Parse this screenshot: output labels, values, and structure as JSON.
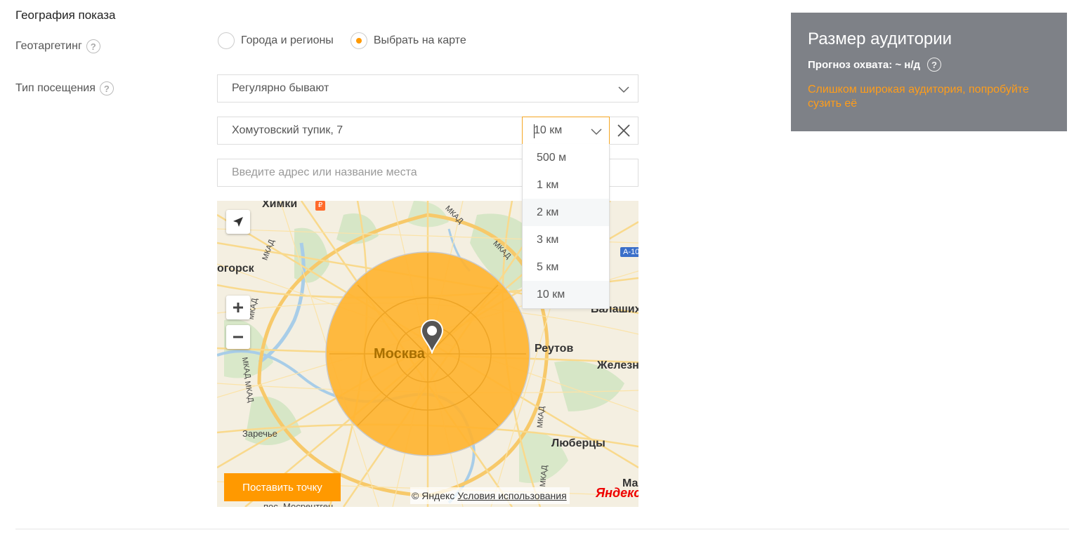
{
  "section": {
    "title": "География показа"
  },
  "geotargeting": {
    "label": "Геотаргетинг",
    "help": "?",
    "options": [
      {
        "label": "Города и регионы",
        "selected": false
      },
      {
        "label": "Выбрать на карте",
        "selected": true
      }
    ]
  },
  "visit_type": {
    "label": "Тип посещения",
    "help": "?",
    "value": "Регулярно бывают"
  },
  "address": {
    "value": "Хомутовский тупик, 7",
    "radius_value": "10 км",
    "radius_options": [
      "500 м",
      "1 км",
      "2 км",
      "3 км",
      "5 км",
      "10 км"
    ]
  },
  "search": {
    "placeholder": "Введите адрес или название места"
  },
  "map": {
    "labels": {
      "khimki": "Химки",
      "dolgoprudny": "огорск",
      "balashikha": "Балашиха",
      "reutov": "Реутов",
      "zheleznodor": "Железн",
      "lyubertsy": "Люберцы",
      "zarechye": "Заречье",
      "moskva": "Москва",
      "mosrentgen": "пос. Мосрентген",
      "ma": "Ма",
      "mkad": "МКАД",
      "a10": "А-10"
    },
    "place_button": "Поставить точку",
    "copyright": "© Яндекс",
    "terms_link": "Условия использования",
    "logo": "Яндекс"
  },
  "audience": {
    "title": "Размер аудитории",
    "forecast": "Прогноз охвата: ~ н/д",
    "help": "?",
    "warning": "Слишком широкая аудитория, попробуйте сузить её"
  },
  "colors": {
    "accent": "#ff9900",
    "panel": "#7e8187",
    "warning": "#ff9d1a"
  }
}
